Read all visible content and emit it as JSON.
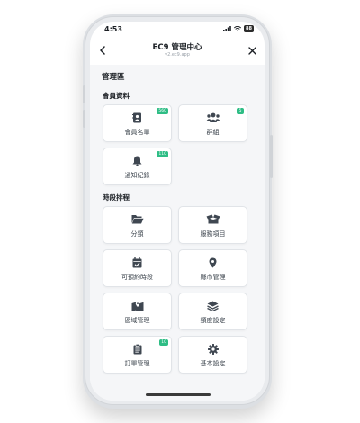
{
  "status_bar": {
    "time": "4:53",
    "battery": "88"
  },
  "nav": {
    "title": "EC9 管理中心",
    "subtitle": "v2.ec9.app"
  },
  "page_title": "管理區",
  "sections": [
    {
      "title": "會員資料",
      "tiles": [
        {
          "label": "會員名單",
          "icon": "address-book-icon",
          "badge": "560"
        },
        {
          "label": "群組",
          "icon": "users-group-icon",
          "badge": "5"
        },
        {
          "label": "通知紀錄",
          "icon": "bell-icon",
          "badge": "110"
        }
      ]
    },
    {
      "title": "時段排程",
      "tiles": [
        {
          "label": "分類",
          "icon": "folder-open-icon"
        },
        {
          "label": "服務項目",
          "icon": "box-open-icon"
        },
        {
          "label": "可預約時段",
          "icon": "calendar-check-icon"
        },
        {
          "label": "縣市管理",
          "icon": "map-marker-icon"
        },
        {
          "label": "區域管理",
          "icon": "map-location-icon"
        },
        {
          "label": "類度設定",
          "icon": "layers-icon"
        },
        {
          "label": "訂單管理",
          "icon": "clipboard-list-icon",
          "badge": "10"
        },
        {
          "label": "基本設定",
          "icon": "gear-icon"
        }
      ]
    }
  ],
  "colors": {
    "accent": "#2ebd85",
    "icon": "#3f4751",
    "background": "#f5f6f8"
  }
}
